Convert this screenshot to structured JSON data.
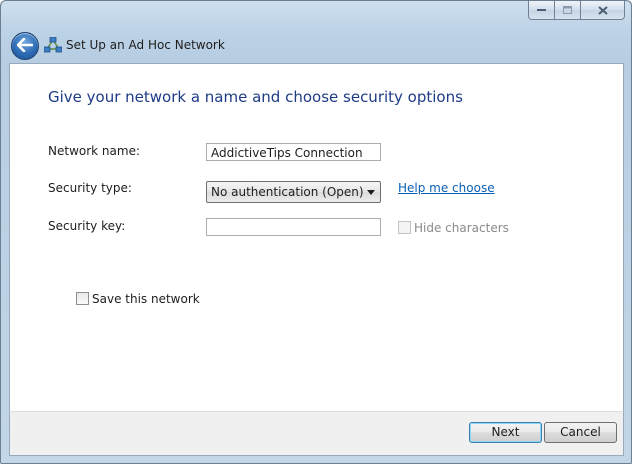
{
  "window": {
    "title": "Set Up an Ad Hoc Network",
    "caption_buttons": [
      "minimize-icon",
      "maximize-icon",
      "close-icon"
    ]
  },
  "header": {
    "back_icon": "back-arrow-icon",
    "title_icon": "ad-hoc-network-icon"
  },
  "main": {
    "heading": "Give your network a name and choose security options",
    "network_name_label": "Network name:",
    "network_name_value": "AddictiveTips Connection",
    "security_type_label": "Security type:",
    "security_type_value": "No authentication (Open)",
    "help_link": "Help me choose",
    "security_key_label": "Security key:",
    "security_key_value": "",
    "hide_characters_label": "Hide characters",
    "hide_characters_checked": false,
    "save_network_label": "Save this network",
    "save_network_checked": false
  },
  "footer": {
    "next_label": "Next",
    "cancel_label": "Cancel"
  },
  "colors": {
    "heading": "#1e3b86",
    "link": "#0a5fb6",
    "frame": "#bcd2e6"
  }
}
